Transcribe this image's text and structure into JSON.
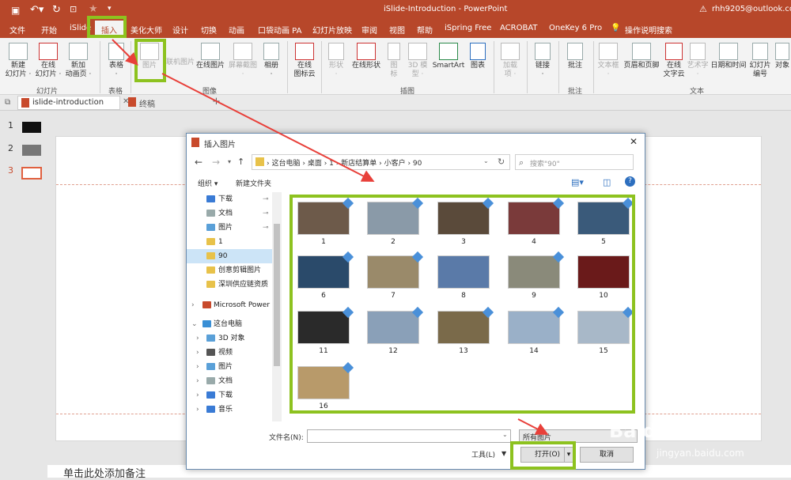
{
  "window": {
    "title": "iSlide-Introduction  -  PowerPoint",
    "account": "rhh9205@outlook.com"
  },
  "tabs": [
    "文件",
    "开始",
    "iSlide",
    "插入",
    "美化大师",
    "设计",
    "切换",
    "动画",
    "口袋动画 PA",
    "幻灯片放映",
    "审阅",
    "视图",
    "帮助",
    "iSpring Free",
    "ACROBAT",
    "OneKey 6 Pro"
  ],
  "tell_me": "操作说明搜索",
  "ribbon": {
    "new_slide": "新建\n幻灯片 ·",
    "online_slide": "在线\n幻灯片 ·",
    "new_anim": "新加\n动画页 ·",
    "table": "表格\n·",
    "picture": "图片",
    "online_picture": "联机图片",
    "online_pic2": "在线图片",
    "screenshot": "屏幕截图\n·",
    "album": "相册\n·",
    "online_icons": "在线\n图标云",
    "shapes": "形状\n·",
    "online_shapes": "在线形状",
    "icons": "图\n标",
    "model3d": "3D 模\n型 ·",
    "smartart": "SmartArt",
    "chart": "图表",
    "addins": "加载\n项 ·",
    "link": "链接\n·",
    "comment": "批注",
    "textbox": "文本框\n·",
    "header_footer": "页眉和页脚",
    "online_text": "在线\n文字云",
    "wordart": "艺术字\n·",
    "datetime": "日期和时间",
    "slide_number": "幻灯片\n编号",
    "object": "对象",
    "groups": {
      "slides": "幻灯片",
      "tables": "表格",
      "images": "图像",
      "illustrations": "插图",
      "comments": "批注",
      "text": "文本"
    }
  },
  "doc_tabs": {
    "tab1": "islide-introduction",
    "tab2": "终稿",
    "add": "+"
  },
  "slides": [
    "1",
    "2",
    "3"
  ],
  "notes_text": "单击此处添加备注",
  "dialog": {
    "title": "插入图片",
    "breadcrumb": [
      "这台电脑",
      "桌面",
      "1",
      "新店结算单",
      "小客户",
      "90"
    ],
    "search_placeholder": "搜索\"90\"",
    "organize": "组织 ▾",
    "new_folder": "新建文件夹",
    "nav": [
      "下载",
      "文档",
      "图片",
      "1",
      "90",
      "创意剪辑图片",
      "深圳供应链资质",
      "Microsoft Power",
      "这台电脑",
      "3D 对象",
      "视频",
      "图片",
      "文档",
      "下载",
      "音乐"
    ],
    "files": [
      "1",
      "2",
      "3",
      "4",
      "5",
      "6",
      "7",
      "8",
      "9",
      "10",
      "11",
      "12",
      "13",
      "14",
      "15",
      "16"
    ],
    "filename_label": "文件名(N):",
    "filename_value": "",
    "filter": "所有图片",
    "tools": "工具(L)",
    "open": "打开(O)",
    "cancel": "取消"
  },
  "watermark": "Baidu 经验",
  "watermark_url": "jingyan.baidu.com",
  "colors": {
    "brand": "#b7472a",
    "highlight": "#8dc21f",
    "arrow": "#e8403a"
  }
}
